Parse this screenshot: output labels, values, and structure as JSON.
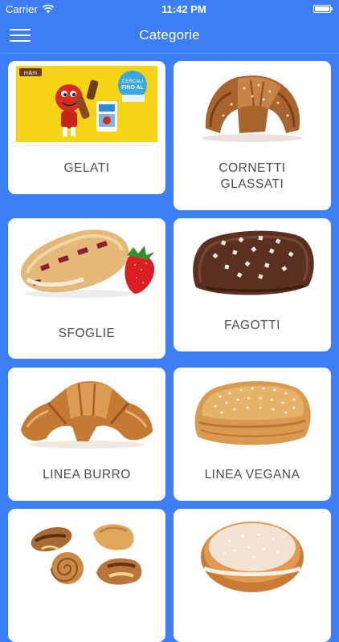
{
  "status": {
    "carrier": "Carrier",
    "time": "11:42 PM",
    "battery_level": 1.0
  },
  "nav": {
    "title": "Categorie"
  },
  "categories": [
    {
      "label": "GELATI",
      "image": "ice-cream-promo-image"
    },
    {
      "label": "CORNETTI\nGLASSATI",
      "image": "glazed-croissant-image"
    },
    {
      "label": "SFOGLIE",
      "image": "puff-pastry-strawberry-image"
    },
    {
      "label": "FAGOTTI",
      "image": "chocolate-fagotto-image"
    },
    {
      "label": "LINEA BURRO",
      "image": "butter-croissant-image"
    },
    {
      "label": "LINEA VEGANA",
      "image": "vegan-pastry-image"
    },
    {
      "label": "",
      "image": "assorted-pastries-image"
    },
    {
      "label": "",
      "image": "krapfen-doughnut-image"
    }
  ],
  "colors": {
    "background": "#3d7ef5",
    "card": "#ffffff",
    "label": "#4c4c4c"
  }
}
